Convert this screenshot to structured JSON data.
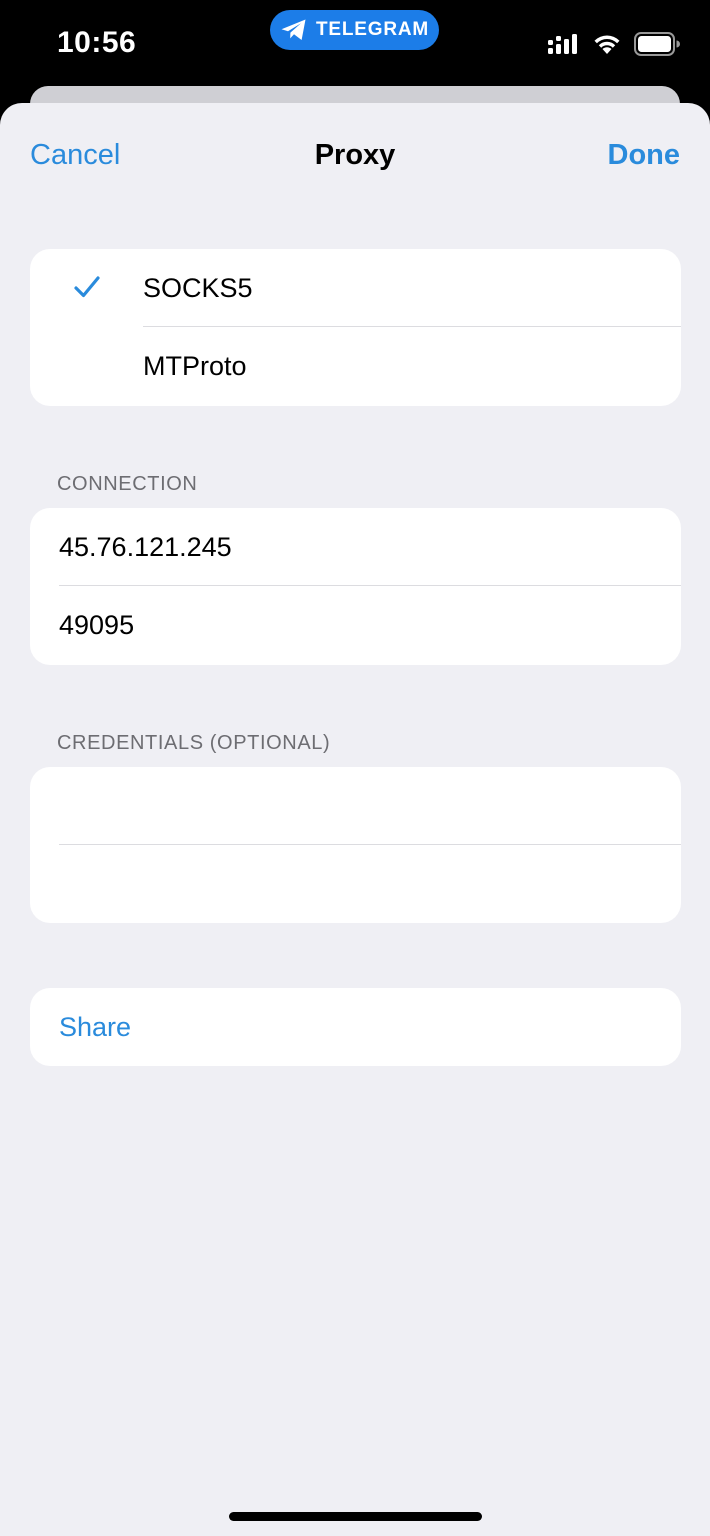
{
  "status_bar": {
    "time": "10:56",
    "app_pill_label": "TELEGRAM",
    "icons": [
      "telegram-icon",
      "signal-icon",
      "wifi-icon",
      "battery-icon"
    ]
  },
  "nav": {
    "cancel_label": "Cancel",
    "title": "Proxy",
    "done_label": "Done"
  },
  "proxy_type": {
    "options": [
      {
        "label": "SOCKS5",
        "selected": true
      },
      {
        "label": "MTProto",
        "selected": false
      }
    ]
  },
  "connection": {
    "header": "CONNECTION",
    "server": "45.76.121.245",
    "port": "49095"
  },
  "credentials": {
    "header": "CREDENTIALS (OPTIONAL)",
    "username": "",
    "password": ""
  },
  "share": {
    "label": "Share"
  },
  "colors": {
    "accent": "#2a8bdc",
    "background": "#efeff4",
    "pill": "#1c7de8"
  }
}
